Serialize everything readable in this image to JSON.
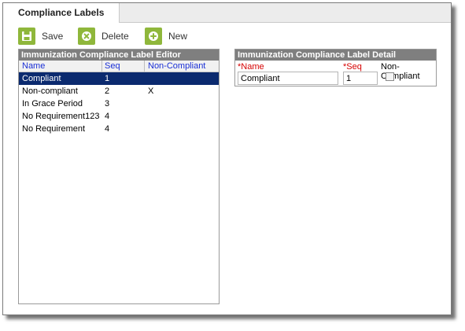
{
  "tab": {
    "label": "Compliance Labels"
  },
  "toolbar": {
    "save_label": "Save",
    "delete_label": "Delete",
    "new_label": "New",
    "icon_color": "#8fb73b"
  },
  "editor": {
    "title": "Immunization Compliance Label Editor",
    "columns": {
      "name": "Name",
      "seq": "Seq",
      "noncompliant": "Non-Compliant"
    },
    "rows": [
      {
        "name": "Compliant",
        "seq": "1",
        "noncompliant": ""
      },
      {
        "name": "Non-compliant",
        "seq": "2",
        "noncompliant": "X"
      },
      {
        "name": "In Grace Period",
        "seq": "3",
        "noncompliant": ""
      },
      {
        "name": "No Requirement123",
        "seq": "4",
        "noncompliant": ""
      },
      {
        "name": "No Requirement",
        "seq": "4",
        "noncompliant": ""
      }
    ],
    "selected_row": 0
  },
  "detail": {
    "title": "Immunization Compliance Label Detail",
    "name_required_mark": "*",
    "name_label": "Name",
    "seq_required_mark": "*",
    "seq_label": "Seq",
    "noncompliant_label": "Non-Compliant",
    "name_value": "Compliant",
    "seq_value": "1",
    "noncompliant_checked": false
  }
}
